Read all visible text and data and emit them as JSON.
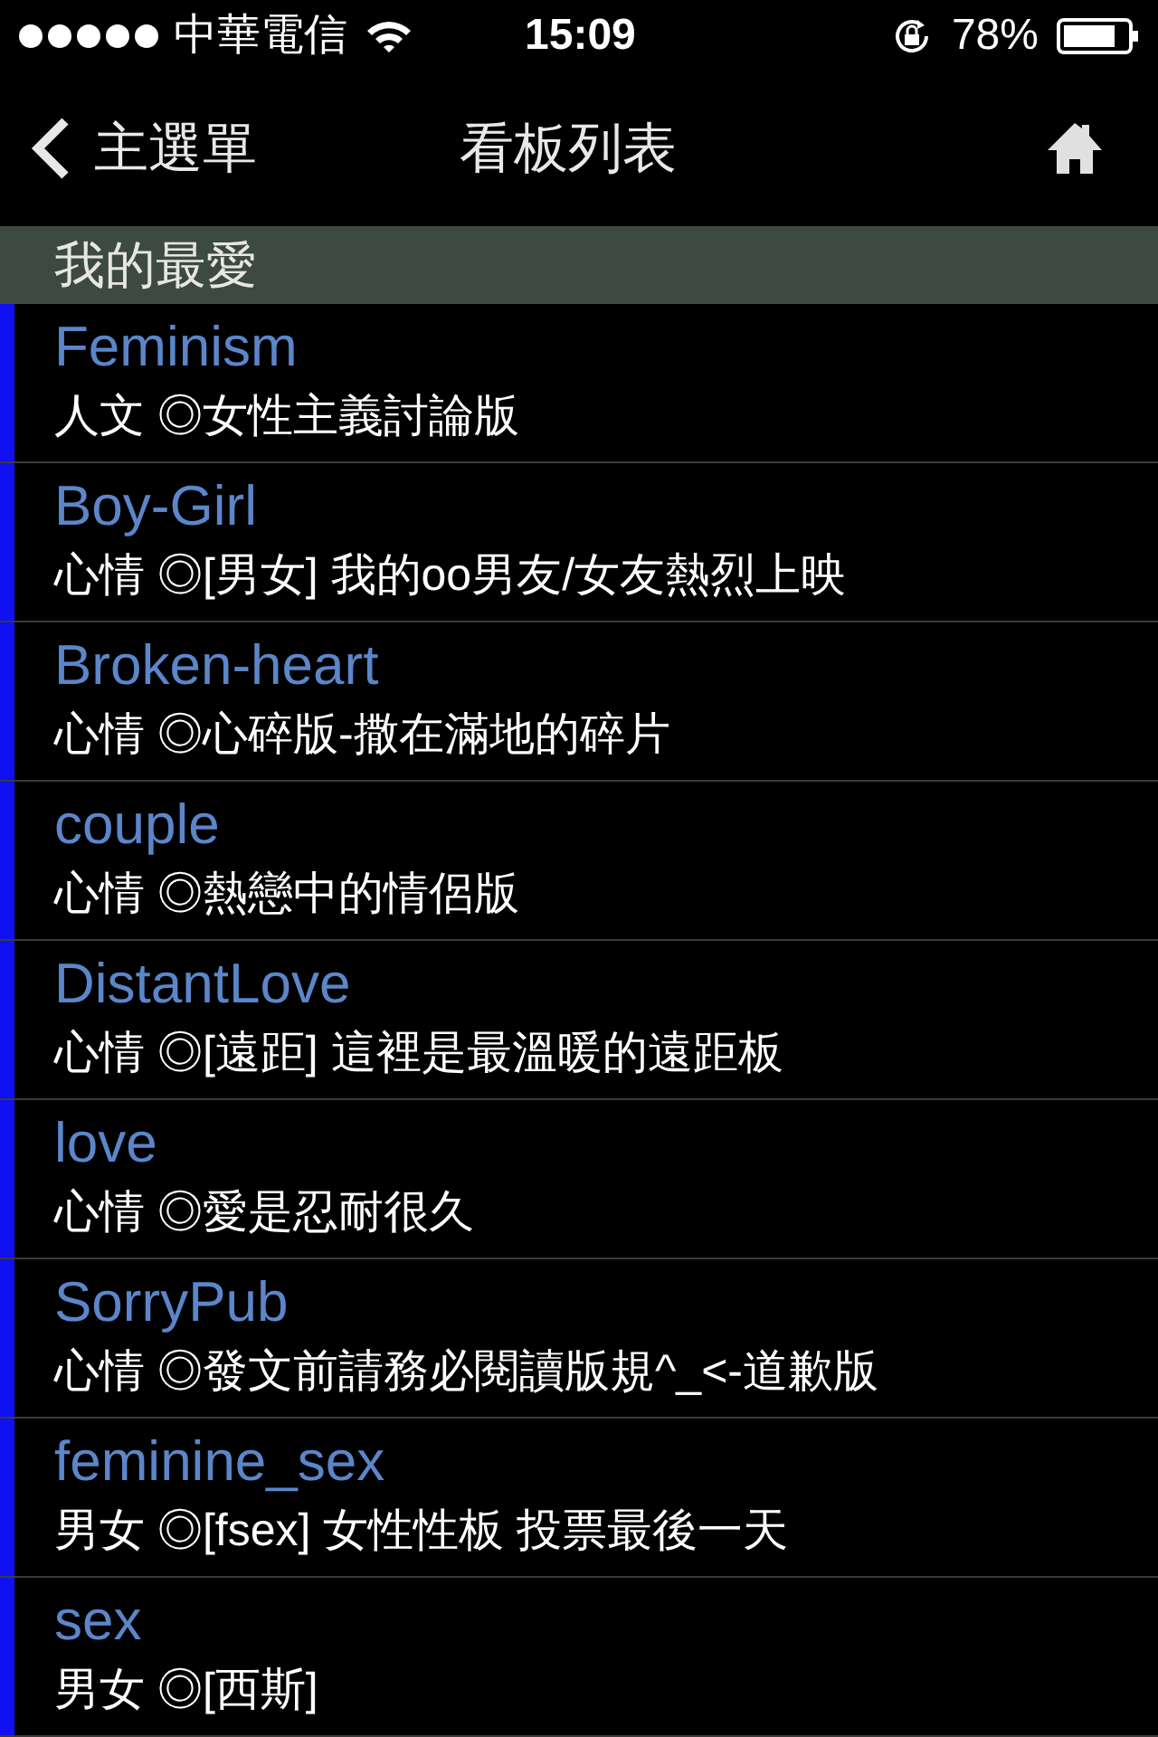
{
  "status_bar": {
    "carrier": "中華電信",
    "time": "15:09",
    "battery": "78%"
  },
  "nav": {
    "back": "主選單",
    "title": "看板列表"
  },
  "section": {
    "title": "我的最愛"
  },
  "boards": [
    {
      "name": "Feminism",
      "description": "人文 ◎女性主義討論版"
    },
    {
      "name": "Boy-Girl",
      "description": "心情 ◎[男女] 我的oo男友/女友熱烈上映"
    },
    {
      "name": "Broken-heart",
      "description": "心情 ◎心碎版-撒在滿地的碎片"
    },
    {
      "name": "couple",
      "description": "心情 ◎熱戀中的情侶版"
    },
    {
      "name": "DistantLove",
      "description": "心情 ◎[遠距] 這裡是最溫暖的遠距板"
    },
    {
      "name": "love",
      "description": "心情 ◎愛是忍耐很久"
    },
    {
      "name": "SorryPub",
      "description": "心情 ◎發文前請務必閱讀版規^_<-道歉版"
    },
    {
      "name": "feminine_sex",
      "description": "男女 ◎[fsex] 女性性板 投票最後一天"
    },
    {
      "name": "sex",
      "description": "男女 ◎[西斯]"
    }
  ]
}
